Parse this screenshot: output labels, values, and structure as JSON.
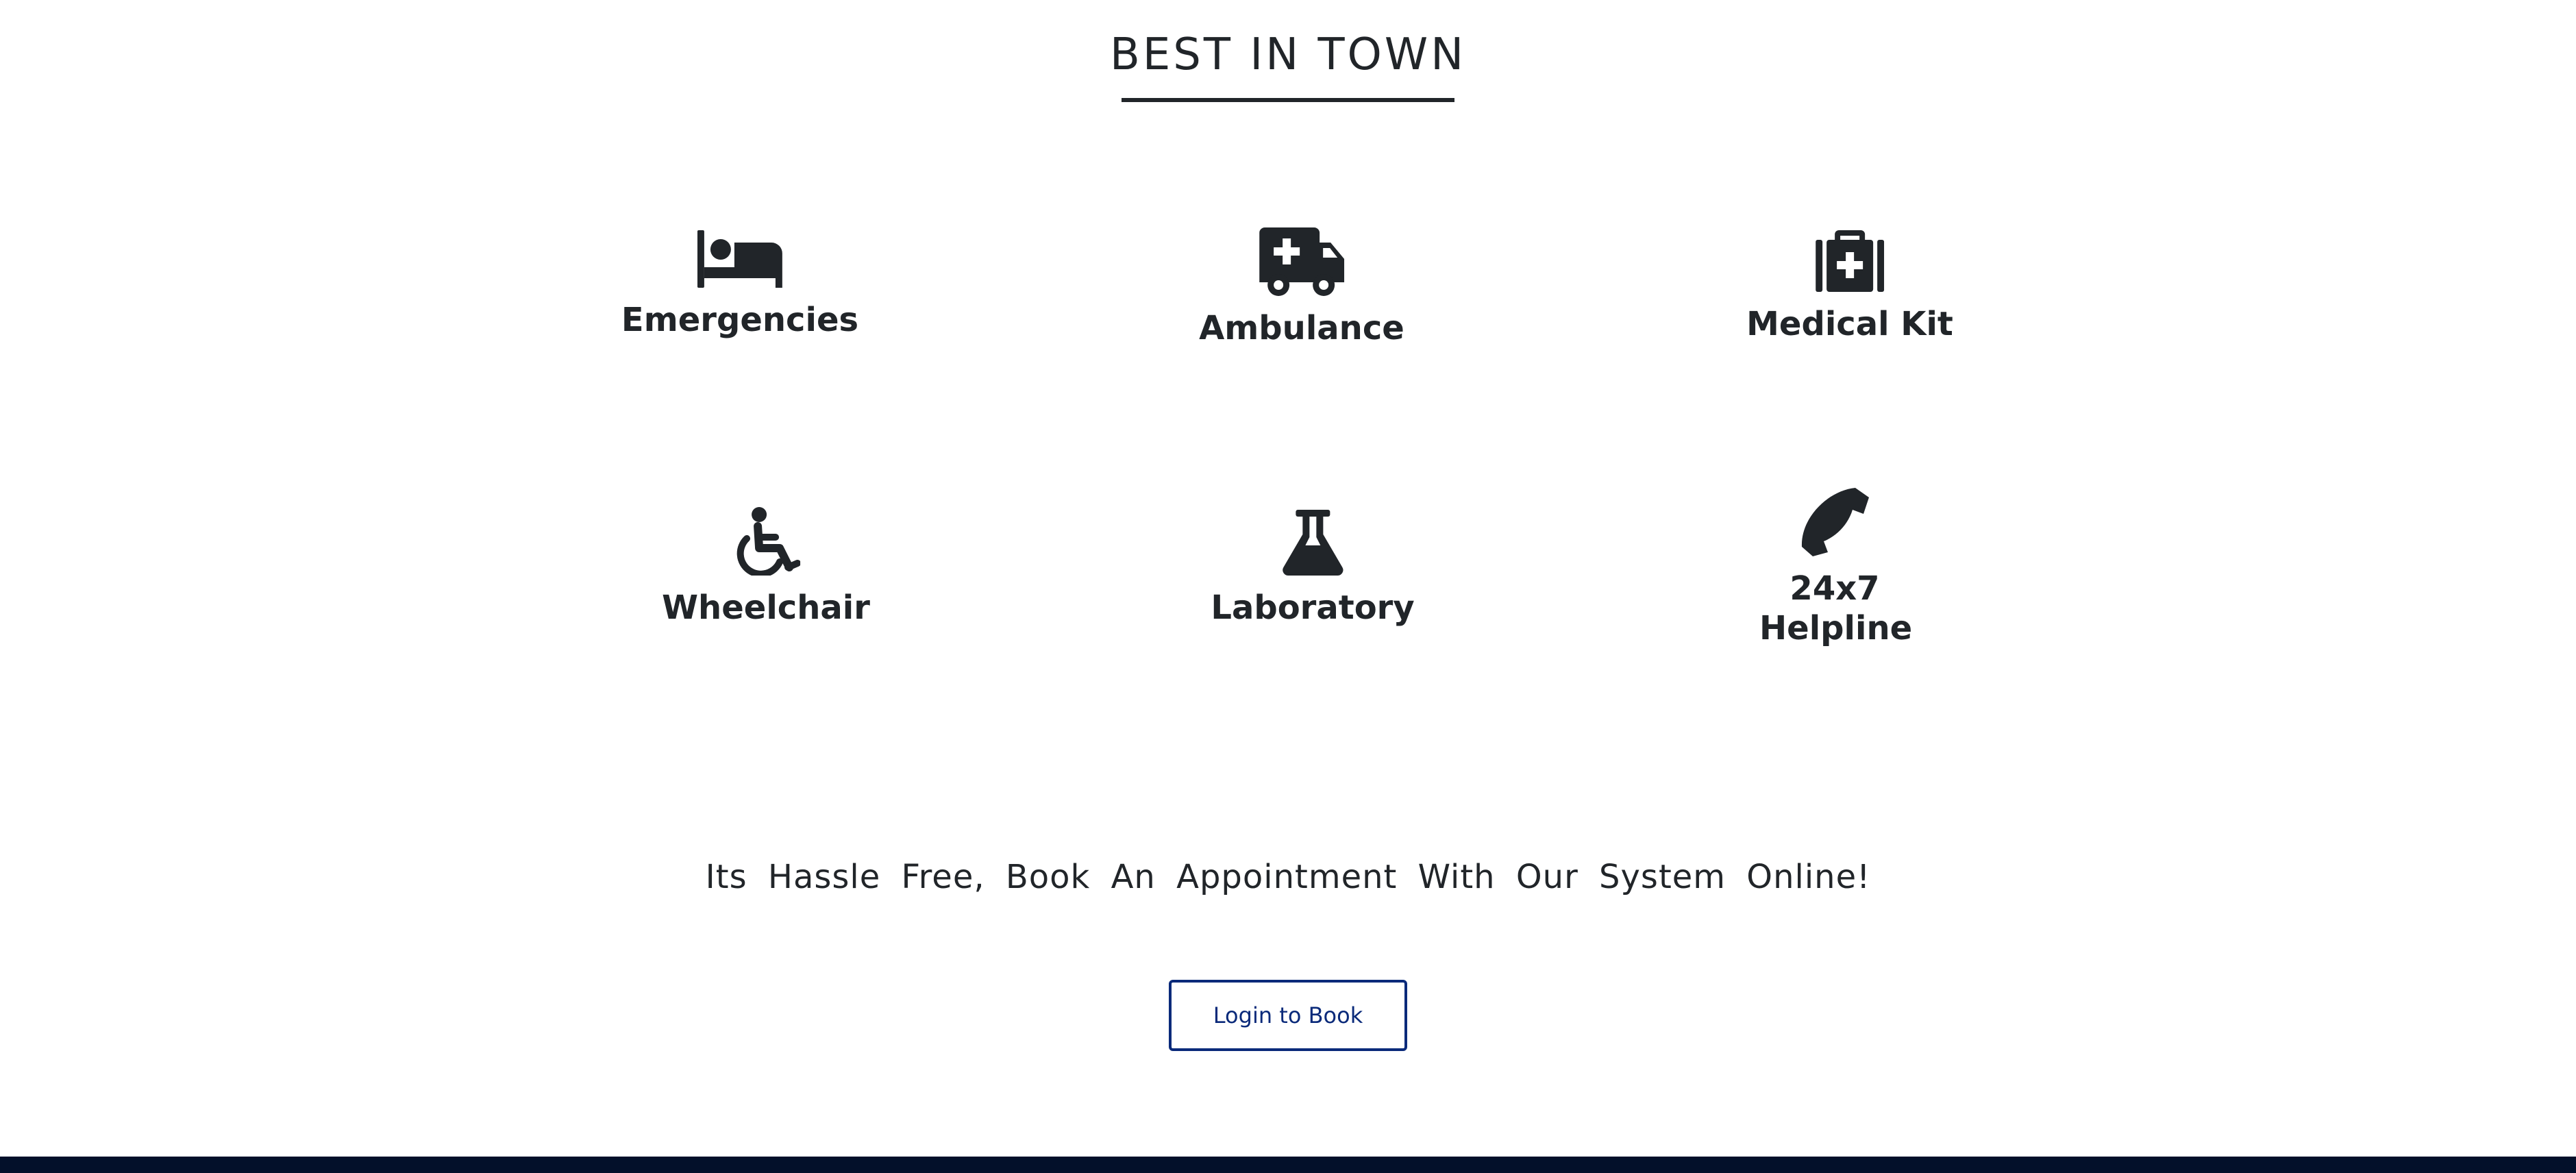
{
  "section": {
    "title": "BEST IN TOWN"
  },
  "services": [
    {
      "label": "Emergencies",
      "icon": "bed-icon"
    },
    {
      "label": "Ambulance",
      "icon": "ambulance-icon"
    },
    {
      "label": "Medical Kit",
      "icon": "medical-kit-icon"
    },
    {
      "label": "Wheelchair",
      "icon": "wheelchair-icon"
    },
    {
      "label": "Laboratory",
      "icon": "flask-icon"
    },
    {
      "label": "24x7 Helpline",
      "icon": "phone-icon"
    }
  ],
  "tagline": "Its Hassle Free, Book An Appointment With Our System Online!",
  "cta": {
    "login_label": "Login to Book"
  },
  "colors": {
    "text": "#212529",
    "button_border": "#0a2a7a",
    "footer": "#03102a"
  }
}
